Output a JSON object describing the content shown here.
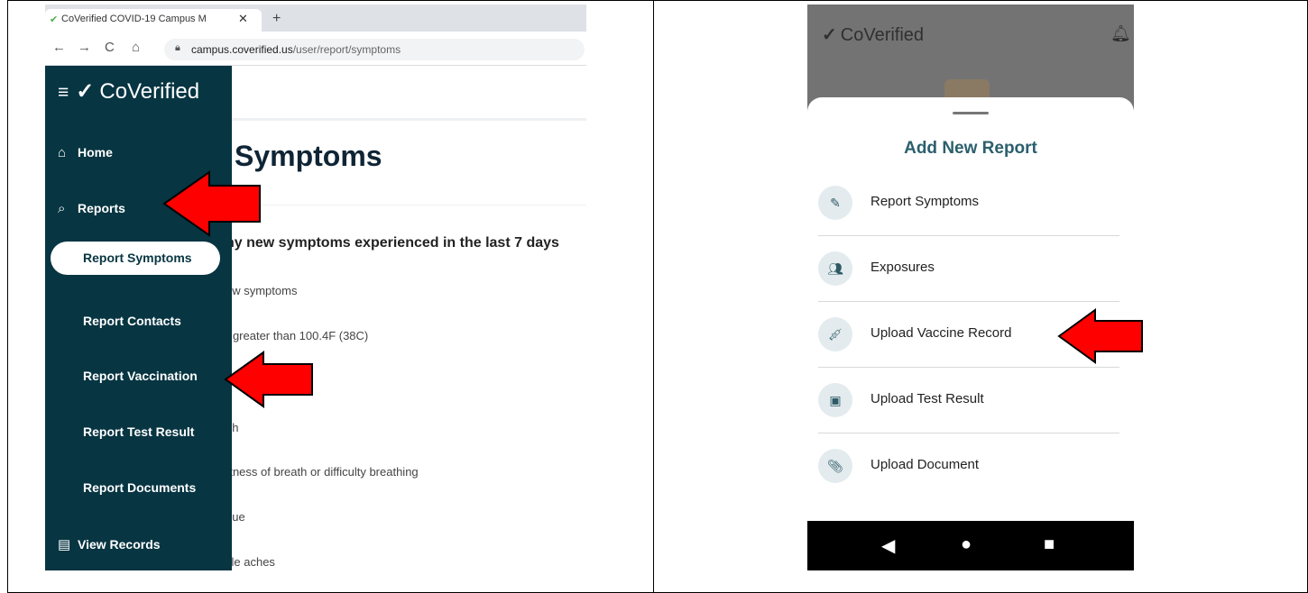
{
  "left_panel": {
    "browser": {
      "tab_title": "CoVerified COVID-19 Campus M",
      "url_host": "campus.coverified.us",
      "url_path": "/user/report/symptoms"
    },
    "sidebar": {
      "brand": "CoVerified",
      "items": [
        {
          "label": "Home",
          "icon": "home-icon"
        },
        {
          "label": "Reports",
          "icon": "search-icon"
        }
      ],
      "sub_items": [
        {
          "label": "Report Symptoms"
        },
        {
          "label": "Report Contacts"
        },
        {
          "label": "Report Vaccination"
        },
        {
          "label": "Report Test Result"
        },
        {
          "label": "Report Documents"
        }
      ],
      "view_records": "View Records"
    },
    "page": {
      "title": "Symptoms",
      "question": "ny new symptoms experienced in the last 7 days",
      "symptoms": [
        "ew symptoms",
        "r greater than 100.4F (38C)",
        "gh",
        "rtness of breath or difficulty breathing",
        "gue",
        "cle aches"
      ]
    }
  },
  "right_panel": {
    "app": {
      "brand": "CoVerified"
    },
    "sheet": {
      "title": "Add New Report",
      "rows": [
        {
          "label": "Report Symptoms",
          "icon": "pencil-icon"
        },
        {
          "label": "Exposures",
          "icon": "group-icon"
        },
        {
          "label": "Upload Vaccine Record",
          "icon": "syringe-icon"
        },
        {
          "label": "Upload Test Result",
          "icon": "test-result-icon"
        },
        {
          "label": "Upload Document",
          "icon": "paperclip-icon"
        }
      ]
    }
  },
  "colors": {
    "sidebar": "#073542",
    "arrow": "#ff0000",
    "sheet_title": "#2b5f6d"
  }
}
